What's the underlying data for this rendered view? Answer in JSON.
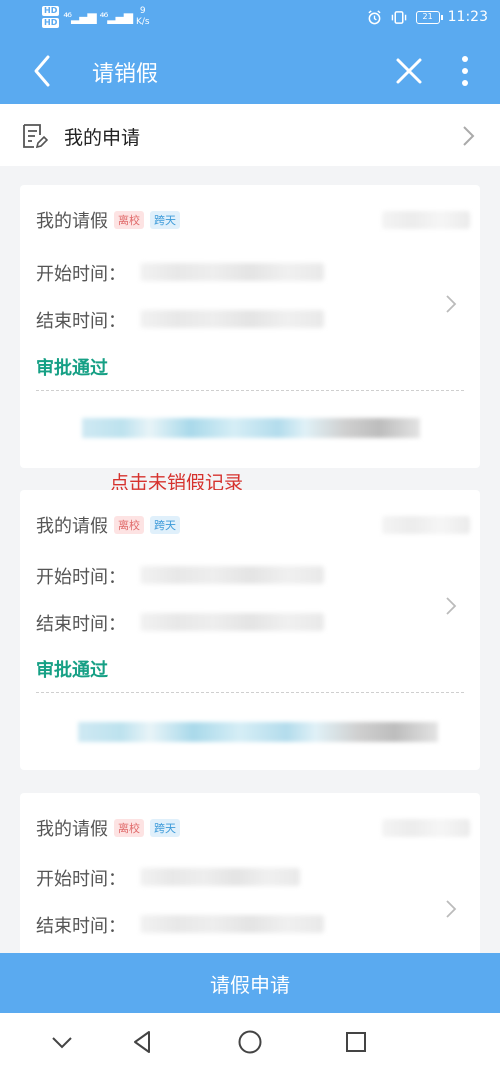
{
  "status_bar": {
    "hd1": "HD",
    "hd2": "HD",
    "speed_value": "9",
    "speed_unit": "K/s",
    "battery": "21",
    "time": "11:23"
  },
  "navbar": {
    "title": "请销假"
  },
  "my_application": {
    "label": "我的申请"
  },
  "cards": [
    {
      "title": "我的请假",
      "tag_leave_school": "离校",
      "tag_cross_day": "跨天",
      "start_label": "开始时间：",
      "end_label": "结束时间：",
      "status": "审批通过"
    },
    {
      "title": "我的请假",
      "tag_leave_school": "离校",
      "tag_cross_day": "跨天",
      "start_label": "开始时间：",
      "end_label": "结束时间：",
      "status": "审批通过"
    },
    {
      "title": "我的请假",
      "tag_leave_school": "离校",
      "tag_cross_day": "跨天",
      "start_label": "开始时间：",
      "end_label": "结束时间："
    }
  ],
  "annotation": "点击未销假记录",
  "submit_button": "请假申请",
  "colors": {
    "accent": "#5aaaf0",
    "approved": "#16a085",
    "annotation": "#d6322e"
  }
}
